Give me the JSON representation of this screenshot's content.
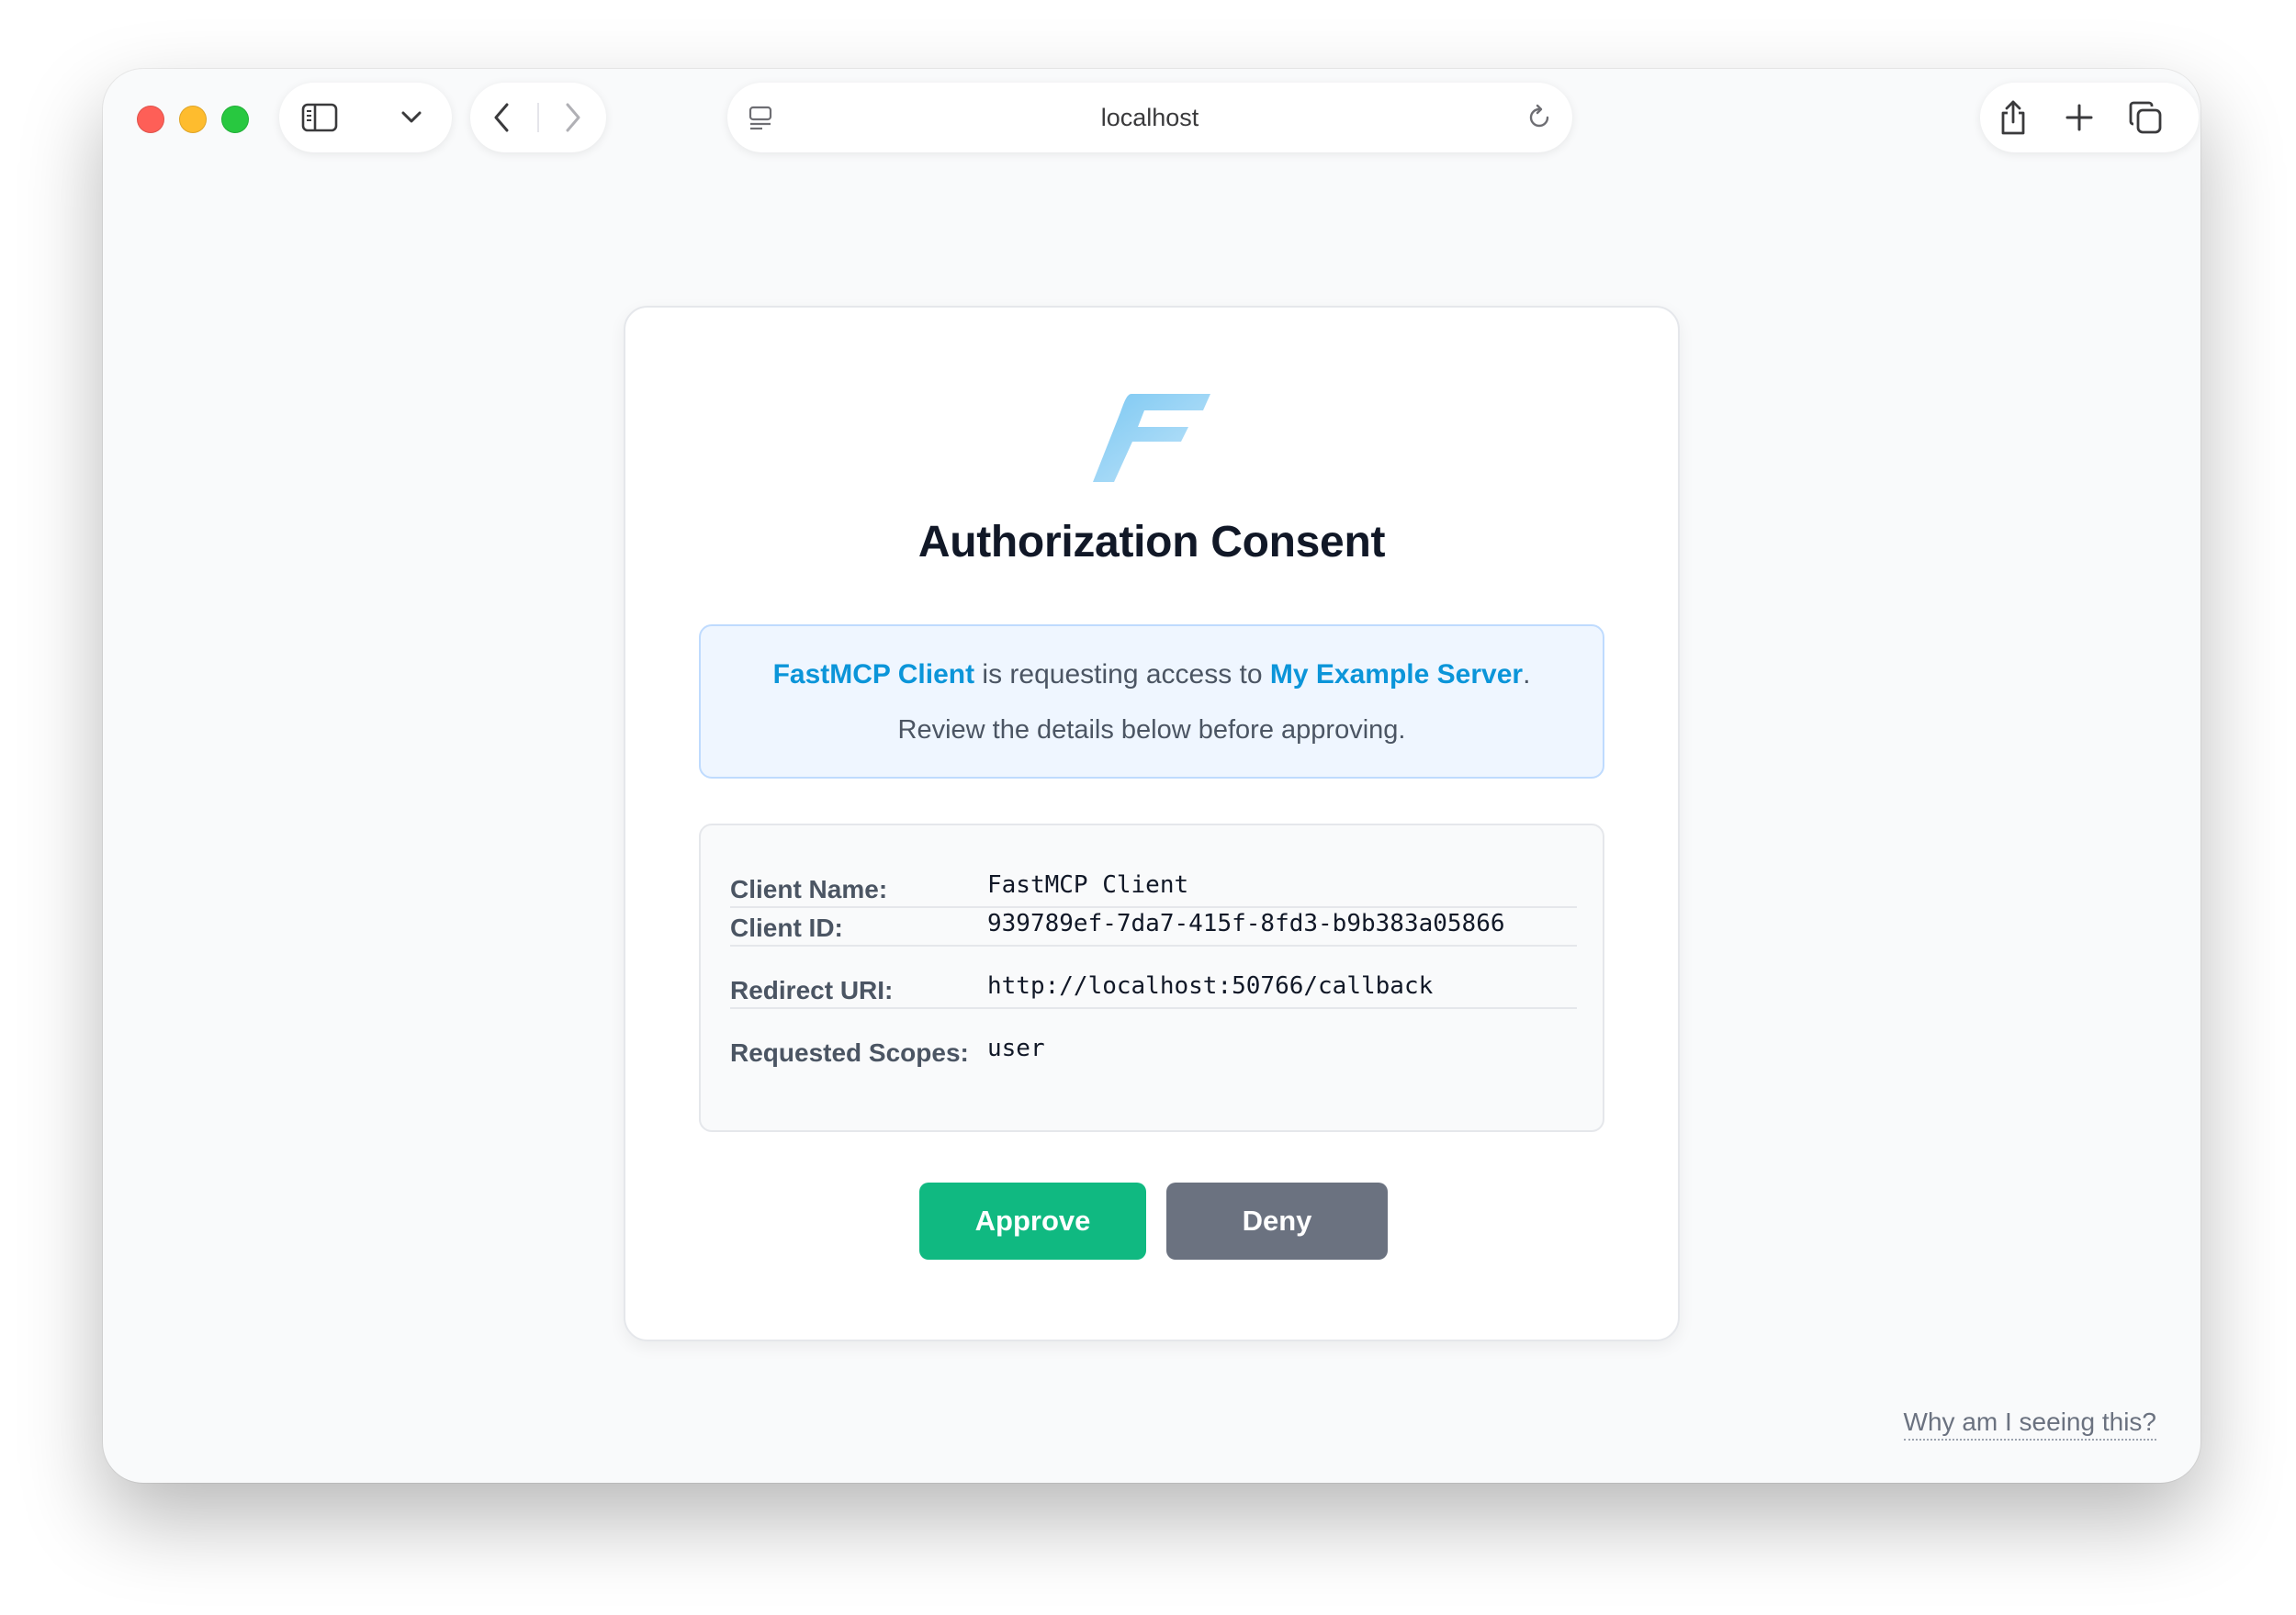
{
  "browser": {
    "address": "localhost"
  },
  "page": {
    "title": "Authorization Consent",
    "notice": {
      "client_name": "FastMCP Client",
      "requesting_text": " is requesting access to ",
      "server_name": "My Example Server",
      "end_punct": ".",
      "review_text": "Review the details below before approving."
    },
    "details": [
      {
        "label": "Client Name:",
        "value": "FastMCP Client"
      },
      {
        "label": "Client ID:",
        "value": "939789ef-7da7-415f-8fd3-b9b383a05866"
      },
      {
        "label": "Redirect URI:",
        "value": "http://localhost:50766/callback"
      },
      {
        "label": "Requested Scopes:",
        "value": "user"
      }
    ],
    "approve_label": "Approve",
    "deny_label": "Deny",
    "why_link": "Why am I seeing this?"
  },
  "colors": {
    "accent": "#0b95d9",
    "approve": "#10b981",
    "deny": "#6b7280"
  },
  "icons": [
    "sidebar-icon",
    "chevron-down-icon",
    "back-icon",
    "forward-icon",
    "page-menu-icon",
    "reload-icon",
    "share-icon",
    "new-tab-icon",
    "tabs-overview-icon",
    "fastmcp-logo"
  ]
}
